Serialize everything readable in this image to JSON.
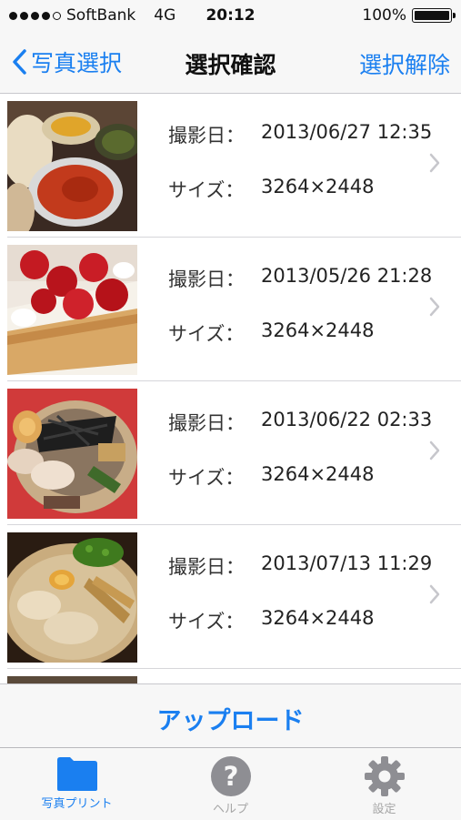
{
  "status_bar": {
    "carrier": "SoftBank",
    "network": "4G",
    "time": "20:12",
    "battery": "100%"
  },
  "nav": {
    "back_label": "写真選択",
    "title": "選択確認",
    "right_label": "選択解除"
  },
  "list": {
    "date_label": "撮影日：",
    "size_label": "サイズ：",
    "items": [
      {
        "date": "2013/06/27 12:35",
        "size": "3264×2448",
        "thumb_icon": "photo-curry-meal"
      },
      {
        "date": "2013/05/26 21:28",
        "size": "3264×2448",
        "thumb_icon": "photo-strawberry-cake"
      },
      {
        "date": "2013/06/22 02:33",
        "size": "3264×2448",
        "thumb_icon": "photo-soba-noodles"
      },
      {
        "date": "2013/07/13 11:29",
        "size": "3264×2448",
        "thumb_icon": "photo-ramen"
      }
    ]
  },
  "upload": {
    "label": "アップロード"
  },
  "tabs": [
    {
      "label": "写真プリント",
      "icon": "folder-icon",
      "active": true
    },
    {
      "label": "ヘルプ",
      "icon": "help-icon",
      "active": false
    },
    {
      "label": "設定",
      "icon": "gear-icon",
      "active": false
    }
  ],
  "colors": {
    "accent": "#1a7ff0",
    "inactive": "#a6a6a6",
    "bar_bg": "#f7f7f7"
  }
}
